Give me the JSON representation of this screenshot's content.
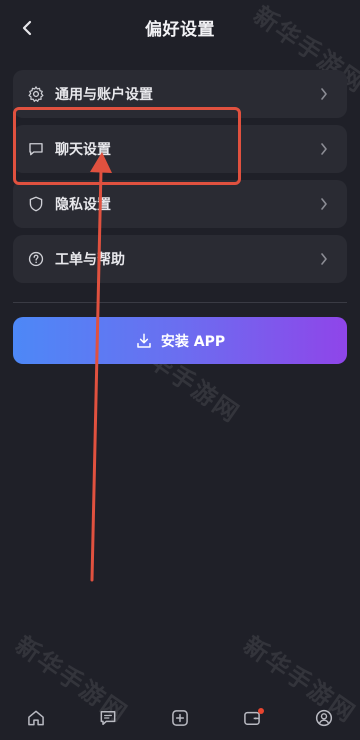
{
  "header": {
    "title": "偏好设置"
  },
  "menu": {
    "items": [
      {
        "label": "通用与账户设置",
        "icon": "gear-icon"
      },
      {
        "label": "聊天设置",
        "icon": "chat-bubble-icon"
      },
      {
        "label": "隐私设置",
        "icon": "shield-icon"
      },
      {
        "label": "工单与帮助",
        "icon": "help-circle-icon"
      }
    ]
  },
  "install": {
    "label": "安装 APP",
    "icon": "download-icon"
  },
  "watermark": {
    "text": "新华手游网"
  },
  "tabbar": {
    "tabs": [
      {
        "icon": "home-icon"
      },
      {
        "icon": "message-icon"
      },
      {
        "icon": "add-icon"
      },
      {
        "icon": "wallet-icon",
        "badge": true
      },
      {
        "icon": "profile-icon"
      }
    ]
  },
  "colors": {
    "background": "#1f2028",
    "card": "#2a2b33",
    "gradient_start": "#4d88f7",
    "gradient_end": "#8f45e9",
    "annotation": "#e0513f",
    "badge": "#e8452f"
  }
}
